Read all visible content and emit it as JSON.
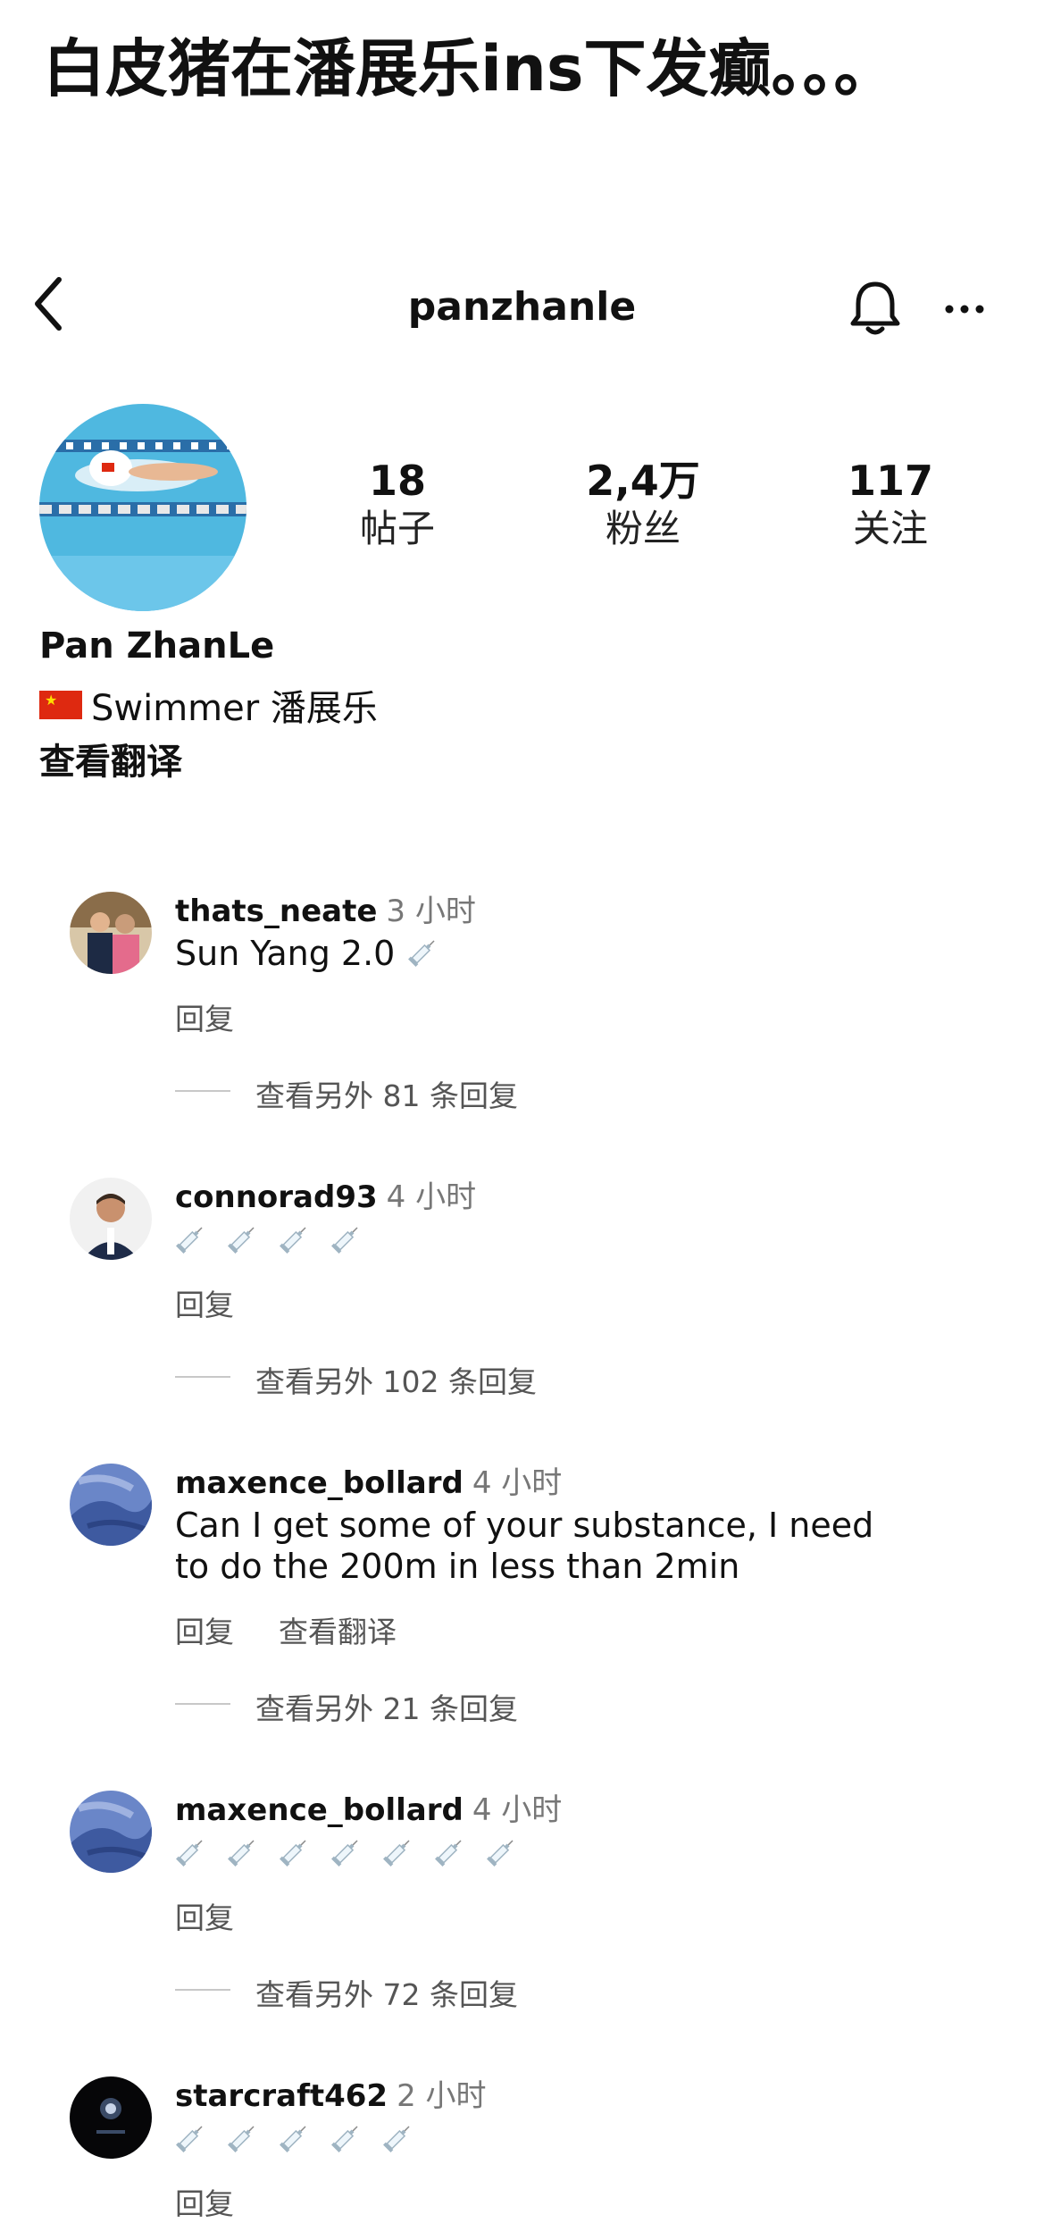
{
  "headline": "白皮猪在潘展乐ins下发癫。。。",
  "nav": {
    "title": "panzhanle",
    "back_icon": "chevron-left-icon",
    "bell_icon": "bell-icon",
    "more_icon": "more-icon"
  },
  "profile": {
    "avatar_icon": "swimming-photo",
    "stats": [
      {
        "value": "18",
        "label": "帖子"
      },
      {
        "value": "2,4万",
        "label": "粉丝"
      },
      {
        "value": "117",
        "label": "关注"
      }
    ],
    "name": "Pan ZhanLe",
    "bio_text": "Swimmer 潘展乐",
    "bio_flag_icon": "china-flag-icon",
    "translate": "查看翻译"
  },
  "comments": [
    {
      "user": "thats_neate",
      "time": "3 小时",
      "text": "Sun Yang 2.0",
      "syringes": 1,
      "reply": "回复",
      "translate": "",
      "more_replies": "查看另外 81 条回复"
    },
    {
      "user": "connorad93",
      "time": "4 小时",
      "text": "",
      "syringes": 4,
      "reply": "回复",
      "translate": "",
      "more_replies": "查看另外 102 条回复"
    },
    {
      "user": "maxence_bollard",
      "time": "4 小时",
      "text": "Can I get some of your substance, I need to do the 200m in less than 2min",
      "syringes": 0,
      "reply": "回复",
      "translate": "查看翻译",
      "more_replies": "查看另外 21 条回复"
    },
    {
      "user": "maxence_bollard",
      "time": "4 小时",
      "text": "",
      "syringes": 7,
      "reply": "回复",
      "translate": "",
      "more_replies": "查看另外 72 条回复"
    },
    {
      "user": "starcraft462",
      "time": "2 小时",
      "text": "",
      "syringes": 5,
      "reply": "回复",
      "translate": "",
      "more_replies": ""
    }
  ],
  "colors": {
    "flag_red": "#de2910",
    "flag_yellow": "#ffde00",
    "pool_blue": "#4fb8e0"
  }
}
